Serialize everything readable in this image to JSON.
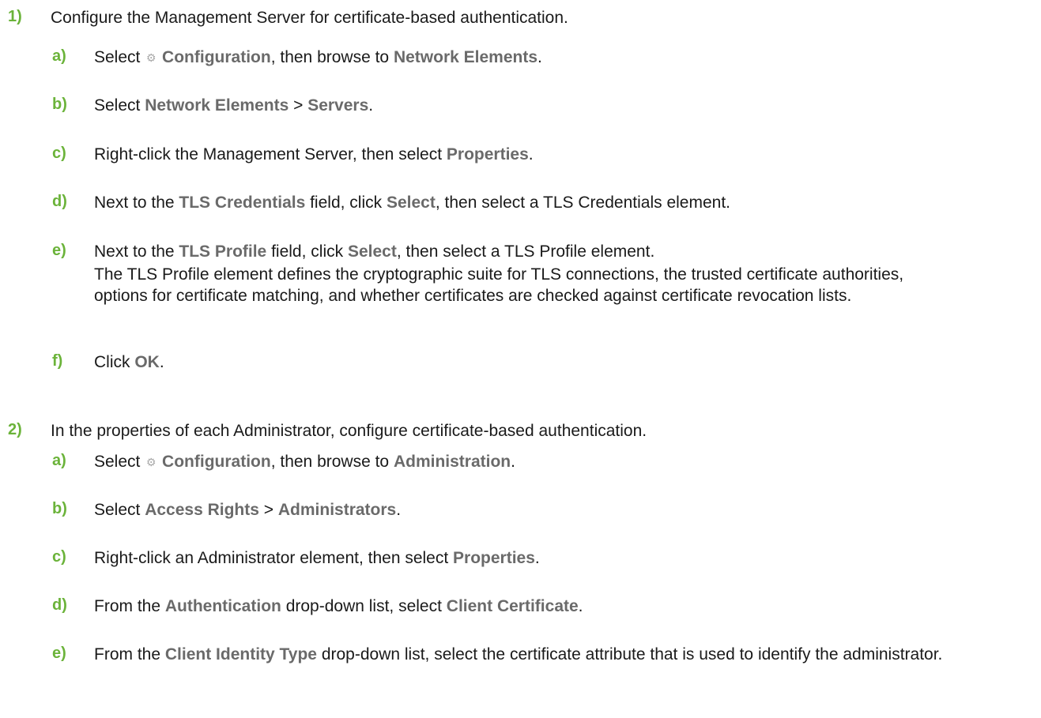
{
  "steps": [
    {
      "num": "1)",
      "text": "Configure the Management Server for certificate-based authentication.",
      "substeps": [
        {
          "letter": "a)",
          "parts": [
            "Select ",
            "Configuration",
            ", then browse to ",
            "Network Elements",
            "."
          ],
          "icon": "gear-icon"
        },
        {
          "letter": "b)",
          "parts": [
            "Select ",
            "Network Elements",
            " > ",
            "Servers",
            "."
          ]
        },
        {
          "letter": "c)",
          "parts": [
            "Right-click the Management Server, then select ",
            "Properties",
            "."
          ]
        },
        {
          "letter": "d)",
          "parts": [
            "Next to the ",
            "TLS Credentials",
            " field, click ",
            "Select",
            ", then select a TLS Credentials element."
          ]
        },
        {
          "letter": "e)",
          "parts": [
            "Next to the ",
            "TLS Profile",
            " field, click ",
            "Select",
            ", then select a TLS Profile element."
          ],
          "note": "The TLS Profile element defines the cryptographic suite for TLS connections, the trusted certificate authorities, options for certificate matching, and whether certificates are checked against certificate revocation lists."
        },
        {
          "letter": "f)",
          "parts": [
            "Click ",
            "OK",
            "."
          ]
        }
      ]
    },
    {
      "num": "2)",
      "text": "In the properties of each Administrator, configure certificate-based authentication.",
      "substeps": [
        {
          "letter": "a)",
          "parts": [
            "Select ",
            "Configuration",
            ", then browse to ",
            "Administration",
            "."
          ],
          "icon": "gear-icon"
        },
        {
          "letter": "b)",
          "parts": [
            "Select ",
            "Access Rights",
            " > ",
            "Administrators",
            "."
          ]
        },
        {
          "letter": "c)",
          "parts": [
            "Right-click an Administrator element, then select ",
            "Properties",
            "."
          ]
        },
        {
          "letter": "d)",
          "parts": [
            "From the ",
            "Authentication",
            " drop-down list, select ",
            "Client Certificate",
            "."
          ]
        },
        {
          "letter": "e)",
          "parts": [
            "From the ",
            "Client Identity Type",
            " drop-down list, select the certificate attribute that is used to identify the administrator."
          ]
        }
      ]
    }
  ],
  "colors": {
    "step_number": "#6bb33a",
    "ui_term": "#6a6a6a",
    "body_text": "#1a1a1a"
  }
}
